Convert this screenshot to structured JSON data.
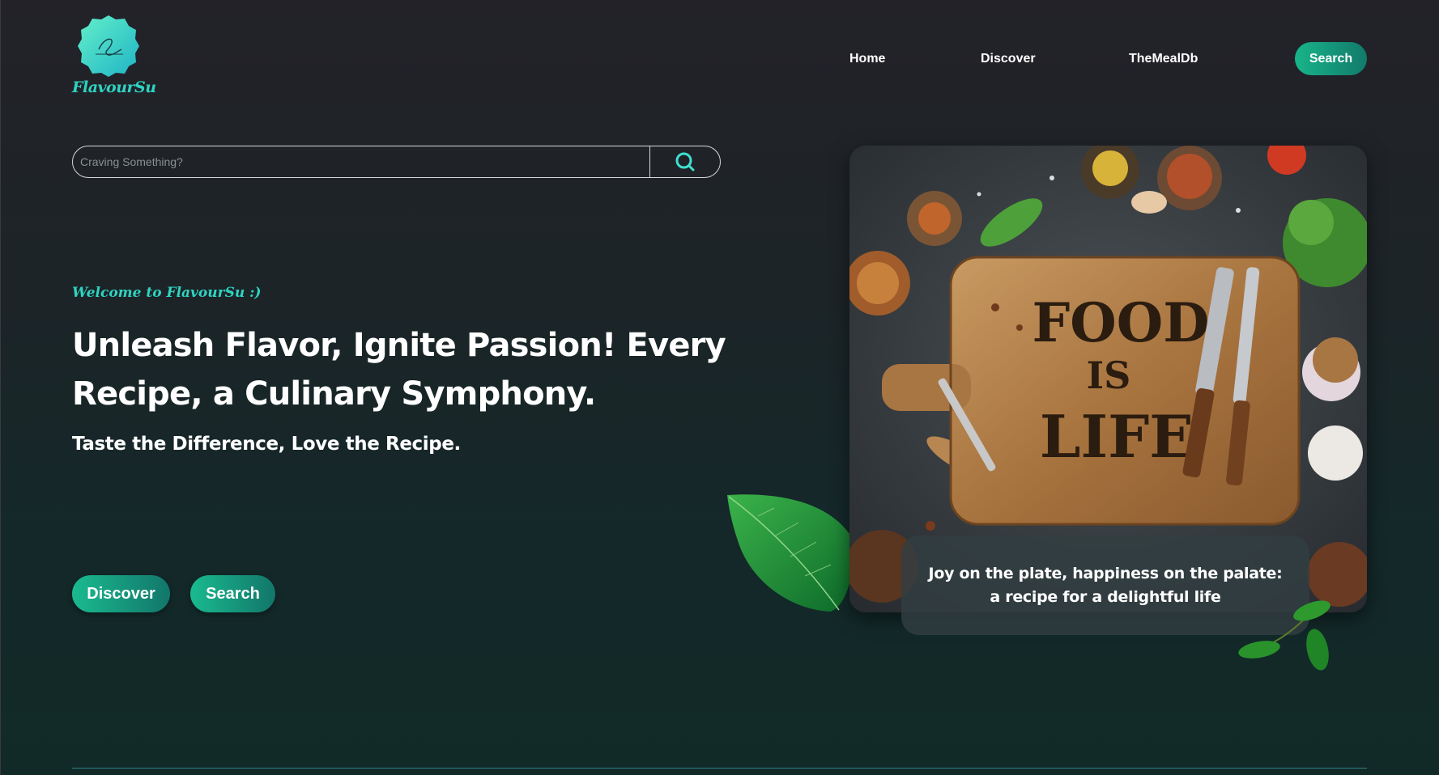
{
  "brand": {
    "name": "FlavourSu",
    "accent": "#2fd3c1"
  },
  "nav": {
    "home": "Home",
    "discover": "Discover",
    "themealdb": "TheMealDb",
    "search": "Search"
  },
  "search": {
    "placeholder": "Craving Something?",
    "icon": "search-icon"
  },
  "hero": {
    "welcome": "Welcome to FlavourSu :)",
    "headline": "Unleash Flavor, Ignite Passion! Every Recipe, a Culinary Symphony.",
    "subline": "Taste the Difference, Love the Recipe.",
    "discover_label": "Discover",
    "search_label": "Search"
  },
  "card": {
    "board_text": [
      "FOOD",
      "IS",
      "LIFE"
    ],
    "caption": "Joy on the plate, happiness on the palate: a recipe for a delightful life"
  },
  "colors": {
    "button_gradient_start": "#1aba8f",
    "button_gradient_end": "#12766a"
  }
}
